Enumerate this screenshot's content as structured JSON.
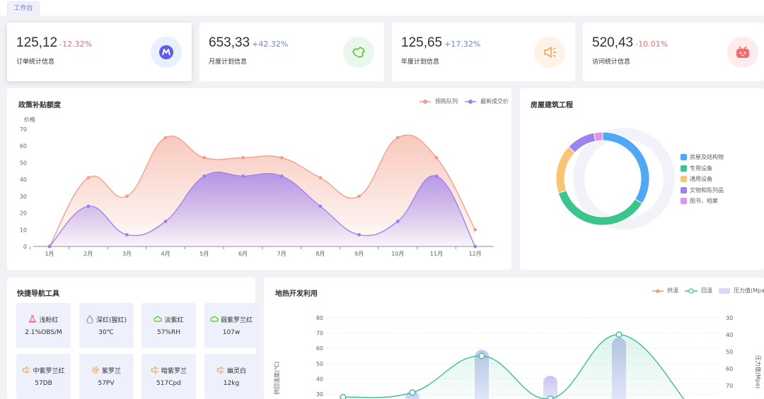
{
  "tab": {
    "label": "工作台"
  },
  "stats": [
    {
      "value": "125,12",
      "pct": "-12.32%",
      "pct_color": "#f56c6c",
      "label": "订单统计信息",
      "icon": "app-logo-icon",
      "icon_bg": "#e8efff"
    },
    {
      "value": "653,33",
      "pct": "+42.32%",
      "pct_color": "#6b84f0",
      "label": "月度计划信息",
      "icon": "map-icon",
      "icon_bg": "#e9f7ec"
    },
    {
      "value": "125,65",
      "pct": "+17.32%",
      "pct_color": "#6b84f0",
      "label": "年度计划信息",
      "icon": "speaker-icon",
      "icon_bg": "#fdf3e6"
    },
    {
      "value": "520,43",
      "pct": "-10.01%",
      "pct_color": "#f56c6c",
      "label": "访问统计信息",
      "icon": "bilibili-icon",
      "icon_bg": "#fdecec"
    }
  ],
  "policy": {
    "title": "政策补贴额度",
    "legend": [
      "预购队列",
      "最新成交价"
    ]
  },
  "housing": {
    "title": "房屋建筑工程",
    "legend": [
      "房屋及结构物",
      "专用设备",
      "通用设备",
      "文物和陈列品",
      "图书、档案"
    ]
  },
  "tools": {
    "title": "快捷导航工具",
    "items": [
      {
        "name": "浅粉红",
        "value": "2.1%OBS/M",
        "icon": "flask-icon",
        "color": "#f56c6c"
      },
      {
        "name": "深红(猩红)",
        "value": "30℃",
        "icon": "drop-icon",
        "color": "#6b9ef0"
      },
      {
        "name": "淡紫红",
        "value": "57%RH",
        "icon": "cloud-icon",
        "color": "#52c41a"
      },
      {
        "name": "弱紫罗兰红",
        "value": "107w",
        "icon": "cloud-icon",
        "color": "#52c41a"
      },
      {
        "name": "中紫罗兰红",
        "value": "57DB",
        "icon": "speaker-icon",
        "color": "#f0a050"
      },
      {
        "name": "紫罗兰",
        "value": "57PV",
        "icon": "gear-icon",
        "color": "#f0a050"
      },
      {
        "name": "暗紫罗兰",
        "value": "517Cpd",
        "icon": "speaker-icon",
        "color": "#f0a050"
      },
      {
        "name": "幽灵白",
        "value": "12kg",
        "icon": "speaker-icon",
        "color": "#f0a050"
      }
    ]
  },
  "geo": {
    "title": "地热开发利用",
    "legend": [
      "供温",
      "回温",
      "压力值(Mpa)"
    ]
  },
  "chart_data": [
    {
      "type": "area",
      "title": "政策补贴额度",
      "ylabel": "价格",
      "categories": [
        "1月",
        "2月",
        "3月",
        "4月",
        "5月",
        "6月",
        "7月",
        "8月",
        "9月",
        "10月",
        "11月",
        "12月"
      ],
      "ylim": [
        0,
        70
      ],
      "yticks": [
        0,
        10,
        20,
        30,
        40,
        50,
        60,
        70
      ],
      "series": [
        {
          "name": "预购队列",
          "color": "#f39c87",
          "values": [
            0,
            41,
            30,
            65,
            53,
            53,
            53,
            41,
            30,
            65,
            53,
            10
          ]
        },
        {
          "name": "最新成交价",
          "color": "#9b7ff0",
          "values": [
            0,
            24,
            7,
            15,
            42,
            42,
            42,
            24,
            7,
            15,
            42,
            0
          ]
        }
      ],
      "legend": "top-right",
      "grid": false
    },
    {
      "type": "pie",
      "title": "房屋建筑工程",
      "labels": [
        "房屋及结构物",
        "专用设备",
        "通用设备",
        "文物和陈列品",
        "图书、档案"
      ],
      "values": [
        34,
        36,
        17,
        10,
        3
      ],
      "colors": [
        "#4ea7f7",
        "#3ac68a",
        "#fcc470",
        "#9b83f0",
        "#e394e3"
      ],
      "legend": "right"
    },
    {
      "type": "line",
      "title": "地热开发利用",
      "ylabel": "供回温度(℃)",
      "y2label": "压力值(Mpa)",
      "ylim": [
        30,
        80
      ],
      "yticks": [
        30,
        40,
        50,
        60,
        70,
        80
      ],
      "y2ticks": [
        30,
        40,
        50,
        60,
        70
      ],
      "series": [
        {
          "name": "回温",
          "color": "#3dbf93",
          "values": [
            28,
            31,
            55,
            27,
            69,
            24
          ]
        },
        {
          "name": "压力值(Mpa)",
          "color": "#c8cdf5",
          "values": [
            0,
            32,
            59,
            42,
            67,
            0
          ]
        }
      ],
      "legend": "top-right",
      "grid": true
    }
  ]
}
